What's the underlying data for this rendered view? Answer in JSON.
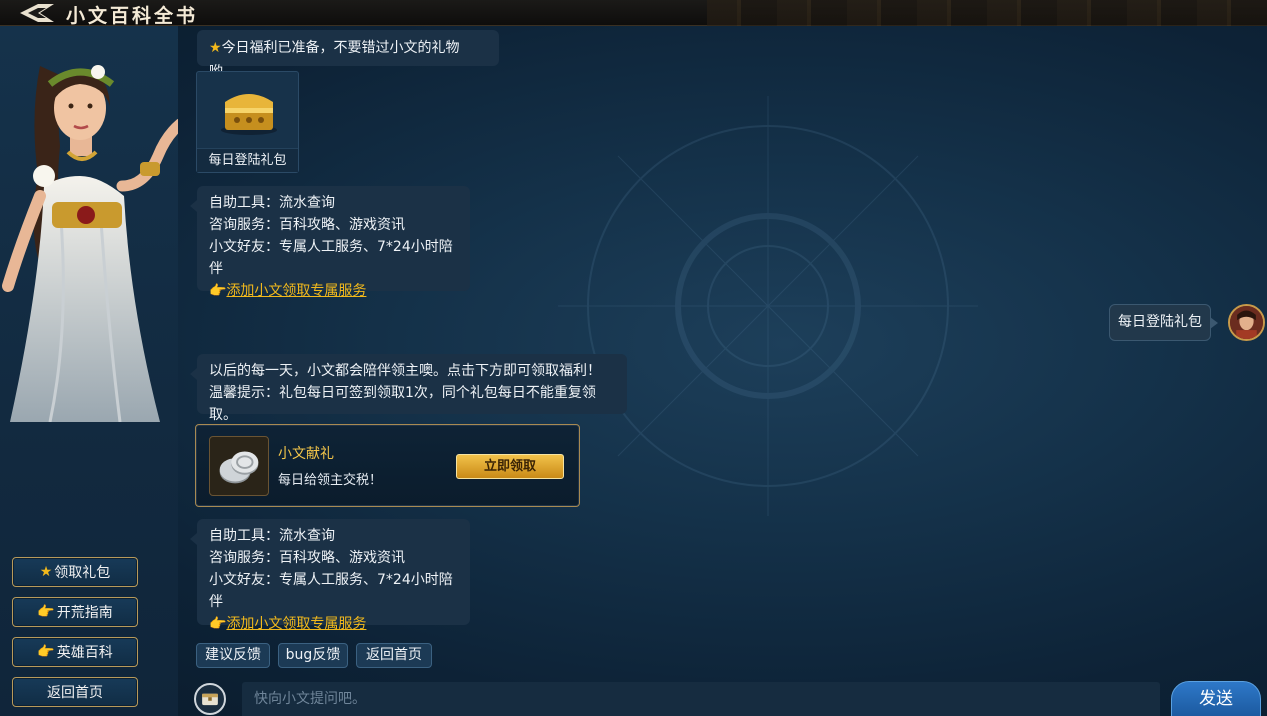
{
  "app": {
    "title": "小文百科全书"
  },
  "sidebar": {
    "buttons": [
      {
        "icon": "★",
        "label": "领取礼包"
      },
      {
        "icon": "👉",
        "label": "开荒指南"
      },
      {
        "icon": "👉",
        "label": "英雄百科"
      },
      {
        "icon": "",
        "label": "返回首页"
      }
    ]
  },
  "chat": {
    "msg1": {
      "icon": "★",
      "text": "今日福利已准备，不要错过小文的礼物哟。"
    },
    "gift_card": {
      "label": "每日登陆礼包"
    },
    "service1": {
      "line1": "自助工具：流水查询",
      "line2": "咨询服务：百科攻略、游戏资讯",
      "line3": "小文好友：专属人工服务、7*24小时陪伴",
      "link_icon": "👉",
      "link": "添加小文领取专属服务"
    },
    "user_msg": {
      "text": "每日登陆礼包"
    },
    "msg2": {
      "line1": "以后的每一天，小文都会陪伴领主噢。点击下方即可领取福利！",
      "line2": "温馨提示：礼包每日可签到领取1次，同个礼包每日不能重复领取。"
    },
    "reward": {
      "title": "小文献礼",
      "desc": "每日给领主交税！",
      "button": "立即领取"
    },
    "service2": {
      "line1": "自助工具：流水查询",
      "line2": "咨询服务：百科攻略、游戏资讯",
      "line3": "小文好友：专属人工服务、7*24小时陪伴",
      "link_icon": "👉",
      "link": "添加小文领取专属服务"
    },
    "quick_buttons": [
      "建议反馈",
      "bug反馈",
      "返回首页"
    ]
  },
  "input": {
    "placeholder": "快向小文提问吧。",
    "send": "发送"
  },
  "colors": {
    "accent_gold": "#f2b91c",
    "send_blue": "#2e78c8",
    "panel": "#1b3146"
  }
}
